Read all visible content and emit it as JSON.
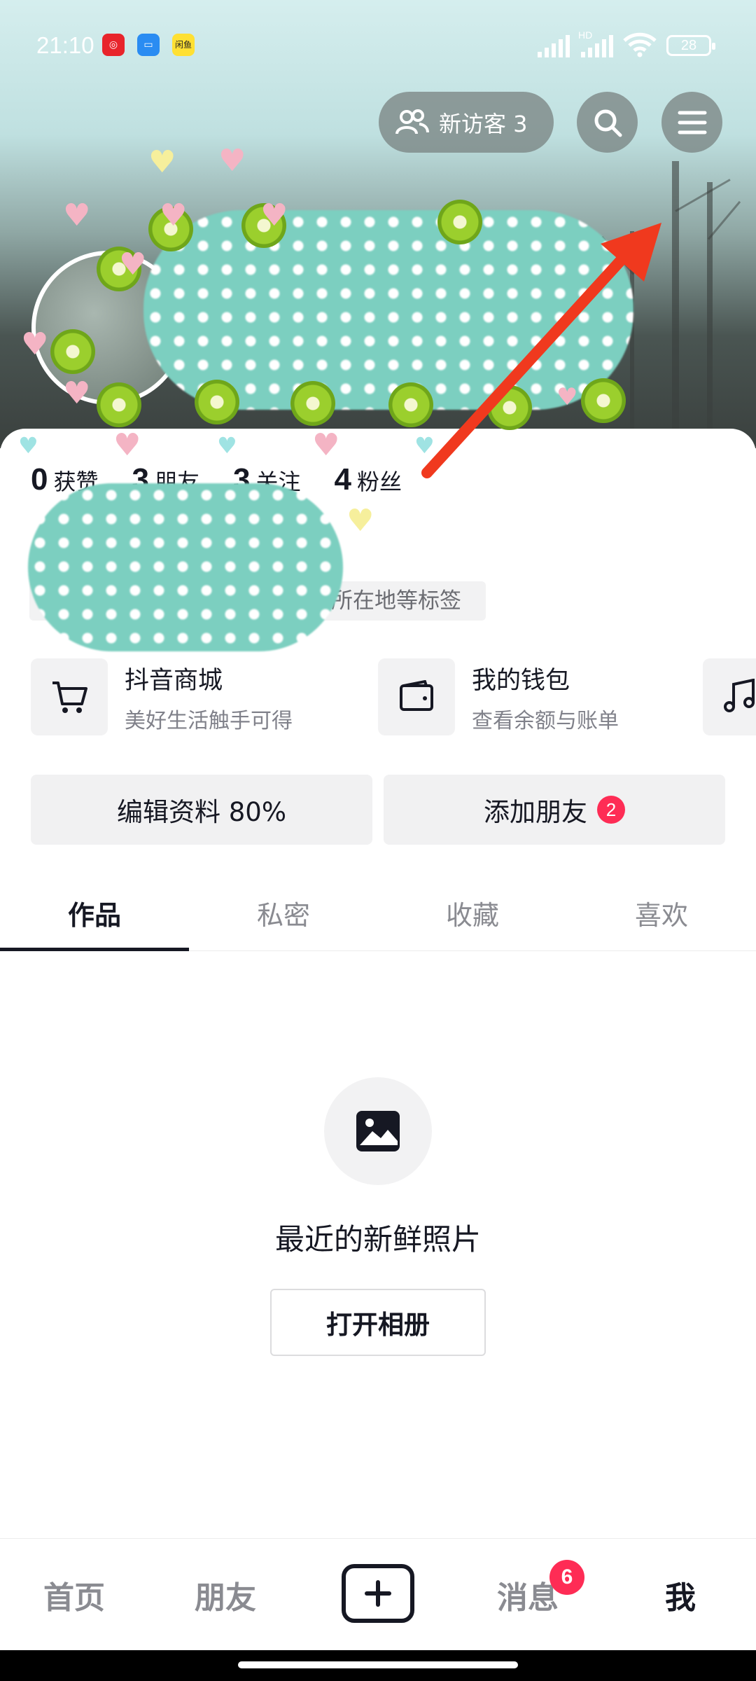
{
  "status_bar": {
    "time": "21:10",
    "network": "HD",
    "battery": "28",
    "notification_icons": [
      "netease-music-icon",
      "calendar-app-icon",
      "xianyu-app-icon"
    ],
    "xianyu_label": "闲鱼"
  },
  "header": {
    "visitors_label": "新访客 3",
    "search_icon": "search-icon",
    "menu_icon": "hamburger-menu-icon"
  },
  "stats": [
    {
      "num": "0",
      "label": "获赞"
    },
    {
      "num": "3",
      "label": "朋友"
    },
    {
      "num": "3",
      "label": "关注"
    },
    {
      "num": "4",
      "label": "粉丝"
    }
  ],
  "profile": {
    "tag_hint": "加所在地等标签"
  },
  "services": [
    {
      "title": "抖音商城",
      "subtitle": "美好生活触手可得",
      "icon": "cart-icon"
    },
    {
      "title": "我的钱包",
      "subtitle": "查看余额与账单",
      "icon": "wallet-icon"
    },
    {
      "icon": "music-note-icon"
    }
  ],
  "actions": {
    "edit_profile": "编辑资料 80%",
    "add_friends": "添加朋友",
    "add_friends_badge": "2"
  },
  "tabs": [
    "作品",
    "私密",
    "收藏",
    "喜欢"
  ],
  "empty_state": {
    "icon": "image-icon",
    "title": "最近的新鲜照片",
    "button": "打开相册"
  },
  "bottom_nav": {
    "home": "首页",
    "friends": "朋友",
    "create_icon": "plus-icon",
    "messages": "消息",
    "messages_badge": "6",
    "me": "我"
  },
  "colors": {
    "accent_red": "#fe2c55",
    "text_primary": "#161823",
    "text_secondary": "#8a8b91",
    "annotation_arrow": "#f0391e"
  }
}
